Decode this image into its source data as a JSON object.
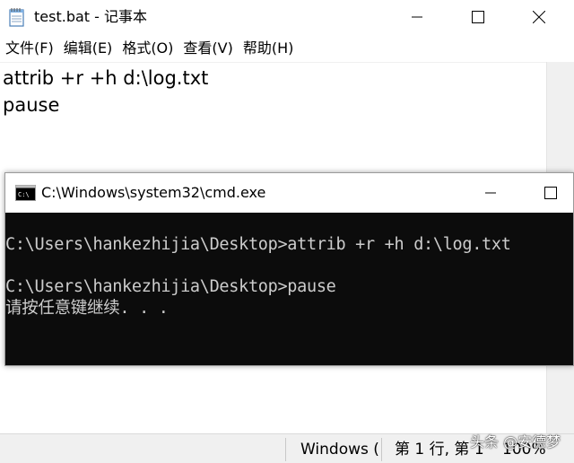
{
  "notepad": {
    "title": "test.bat - 记事本",
    "menu": [
      "文件(F)",
      "编辑(E)",
      "格式(O)",
      "查看(V)",
      "帮助(H)"
    ],
    "lines": [
      "attrib +r +h d:\\log.txt",
      "pause"
    ],
    "status": {
      "encoding_fragment": "Windows (",
      "position": "第 1 行, 第 1",
      "zoom": "100%"
    }
  },
  "cmd": {
    "title": "C:\\Windows\\system32\\cmd.exe",
    "lines": [
      "C:\\Users\\hankezhijia\\Desktop>attrib +r +h d:\\log.txt",
      "C:\\Users\\hankezhijia\\Desktop>pause",
      "请按任意键继续. . ."
    ]
  },
  "watermark": "头条 @安德梦",
  "colors": {
    "cmd_background": "#0c0c0c",
    "cmd_text": "#cccccc",
    "statusbar": "#f0f0f0"
  }
}
